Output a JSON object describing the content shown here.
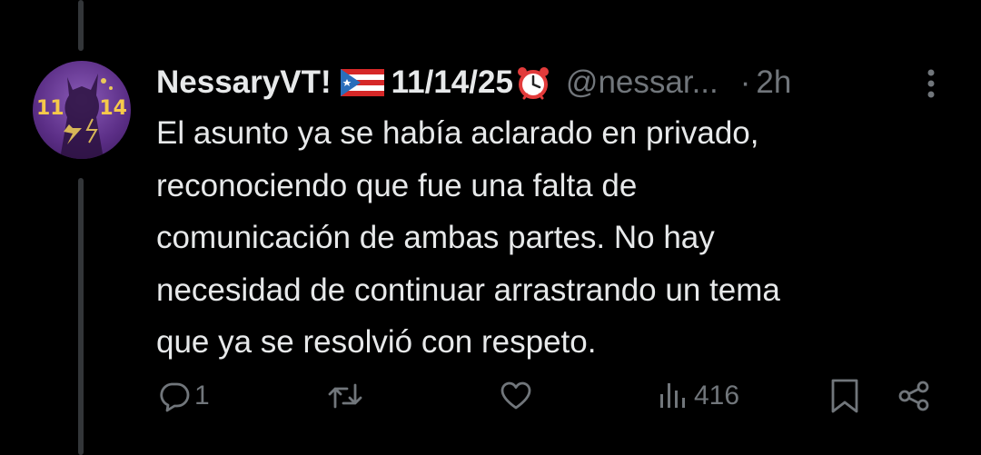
{
  "post": {
    "display_name": "NessaryVT!",
    "flag_icon": "puerto-rico-flag-icon",
    "date_text": "11/14/25",
    "clock_icon": "alarm-clock-icon",
    "handle": "@nessar...",
    "separator": "·",
    "time": "2h",
    "avatar": {
      "left_number": "11",
      "right_number": "14"
    },
    "text_lines": [
      "El asunto ya se había aclarado en privado,",
      "reconociendo que fue una falta de",
      "comunicación de ambas partes. No hay",
      "necesidad de continuar arrastrando un tema",
      "que ya se resolvió con respeto."
    ]
  },
  "actions": {
    "reply_count": "1",
    "repost_count": "",
    "like_count": "",
    "views_count": "416"
  },
  "colors": {
    "background": "#000000",
    "text_primary": "#e7e9ea",
    "text_secondary": "#71767b",
    "thread_line": "#333639",
    "avatar_purple": "#5b2e86"
  }
}
